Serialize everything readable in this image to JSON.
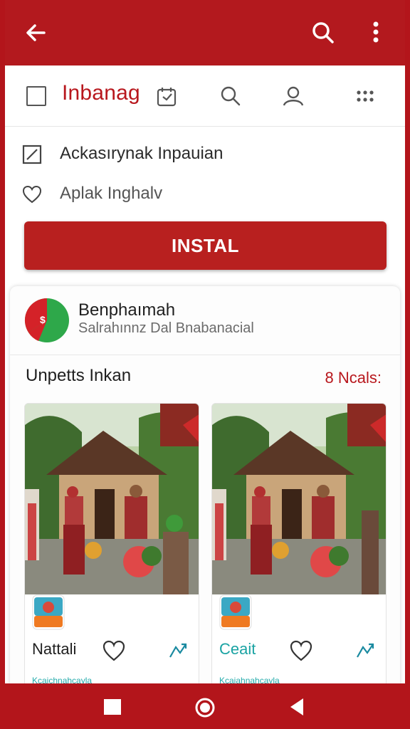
{
  "colors": {
    "brand": "#b3191e",
    "accent_teal": "#1aa3a3",
    "text_dark": "#1f1f1f"
  },
  "appbar": {
    "back_icon": "arrow-left-icon",
    "search_icon": "search-icon",
    "more_icon": "more-vert-icon"
  },
  "toolbar": {
    "title": "Inbanag",
    "title_icon": "tag-calendar-icon",
    "icons": [
      "search-icon",
      "person-icon",
      "grid-dots-icon"
    ]
  },
  "info": {
    "row1": "Ackasırynak  Inpauian",
    "row2": "Aplak Inghalv"
  },
  "install_label": "INSTAL",
  "card": {
    "app_name": "Benphaımah",
    "app_subtitle": "Salrahınnz Dal Bnabanacial",
    "section_title": "Unpetts Inkan",
    "section_count": "8 Ncals:",
    "items": [
      {
        "label": "Nattali",
        "strip": "Kcaichnahcayla"
      },
      {
        "label": "Ceait",
        "strip": "Kcaiahnahcayla"
      }
    ]
  }
}
